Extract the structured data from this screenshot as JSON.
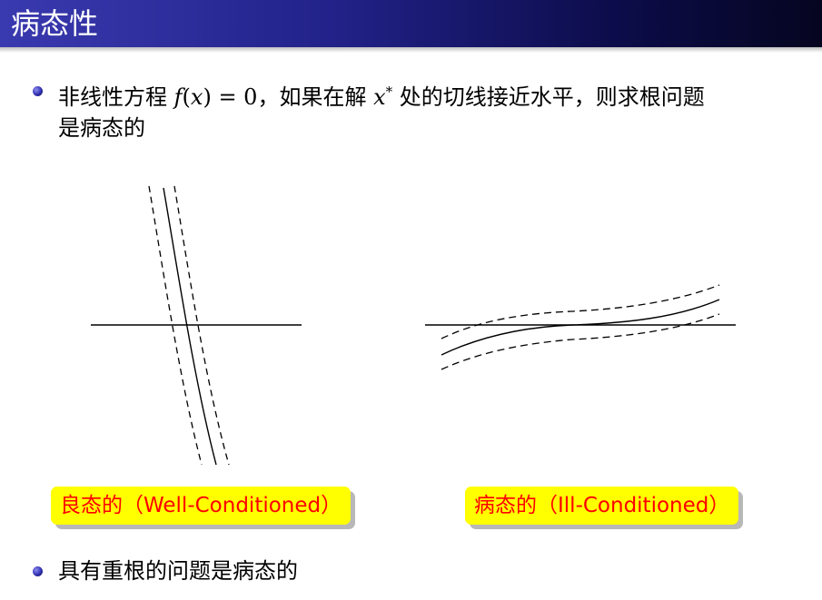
{
  "slide": {
    "title": "病态性",
    "bullet1": {
      "before": "非线性方程 ",
      "fx": "f",
      "lparen": "(",
      "x": "x",
      "rparen_eq": ") = 0",
      "middle": "，如果在解 ",
      "xstar": "x",
      "star": "*",
      "after": " 处的切线接近水平，则求根问题",
      "line2": "是病态的"
    },
    "figure": {
      "left_label": "良态的（Well-Conditioned）",
      "right_label": "病态的（Ill-Conditioned）"
    },
    "bullet2": "具有重根的问题是病态的"
  },
  "colors": {
    "title_bar_dark": "#050520",
    "title_bar_light": "#3a3ab0",
    "label_background": "#ffff00",
    "label_text": "#ff0000"
  }
}
